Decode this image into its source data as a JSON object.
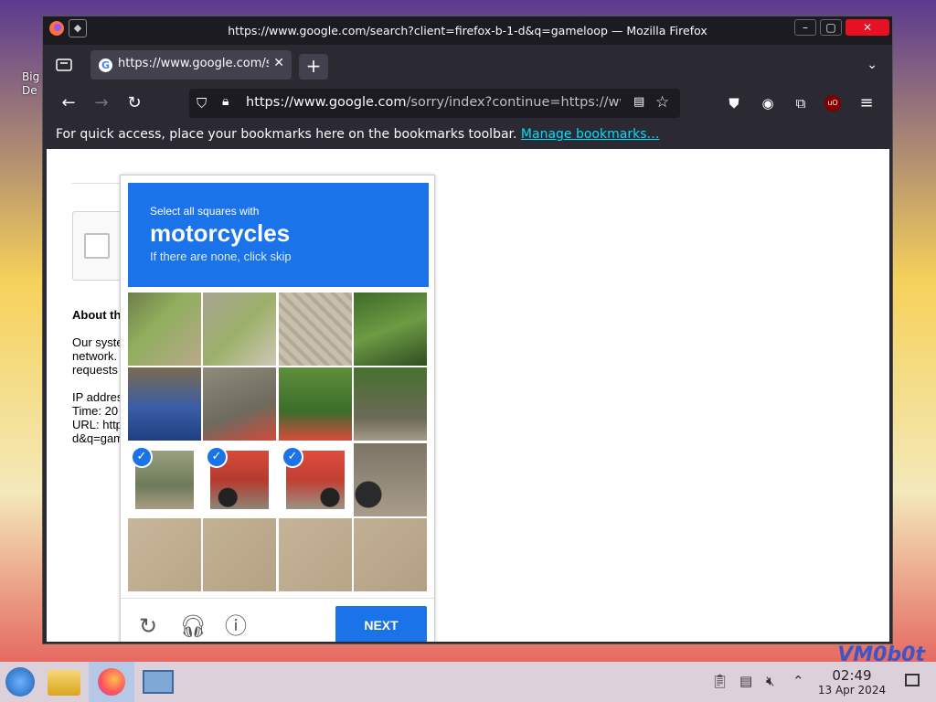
{
  "desktop": {
    "icon_label_partial": "Big\nDe",
    "corner_text": "VM0b0t"
  },
  "window": {
    "title": "https://www.google.com/search?client=firefox-b-1-d&q=gameloop — Mozilla Firefox"
  },
  "tabs": [
    {
      "title": "https://www.google.com/sorry/"
    }
  ],
  "navbar": {
    "url_domain": "https://www.google.com",
    "url_rest": "/sorry/index?continue=https://www"
  },
  "bookmarks_bar": {
    "message": "For quick access, place your bookmarks here on the bookmarks toolbar.",
    "link": "Manage bookmarks…"
  },
  "page": {
    "about_heading": "About th",
    "body_text": "Our syste\nnetwork.\nrequests\n\nIP addres\nTime: 20\nURL: http\nd&q=gam"
  },
  "recaptcha": {
    "instruction": "Select all squares with",
    "target": "motorcycles",
    "skip_hint": "If there are none, click skip",
    "next_label": "NEXT",
    "selected_tiles": [
      8,
      9,
      10
    ]
  },
  "taskbar": {
    "time": "02:49",
    "date": "13 Apr 2024"
  },
  "colors": {
    "recaptcha_blue": "#1a73e8",
    "firefox_dark": "#2b2a33",
    "link_cyan": "#00ddff"
  }
}
